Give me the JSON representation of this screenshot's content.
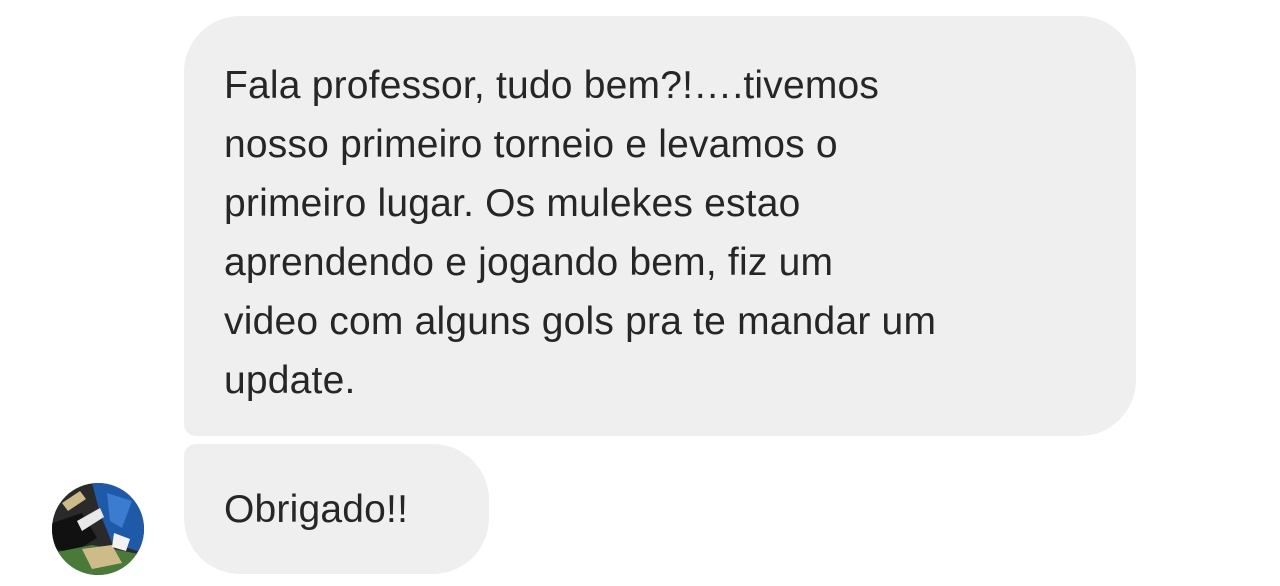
{
  "conversation": {
    "messages": [
      {
        "sender": "other",
        "text": "Fala professor, tudo bem?!….tivemos\nnosso primeiro torneio e levamos o\nprimeiro lugar. Os mulekes estao\naprendendo e jogando bem, fiz um\nvideo com alguns gols pra te mandar um\nupdate."
      },
      {
        "sender": "other",
        "text": "Obrigado!!"
      }
    ],
    "sender_avatar": {
      "icon": "profile-avatar",
      "colors": {
        "blue": "#1e5aa8",
        "dark": "#1a1a1a",
        "green": "#4a7a3a",
        "sand": "#cdbb8a"
      }
    }
  },
  "theme": {
    "bubble_color": "#efefef",
    "text_color": "#262626",
    "background": "#ffffff"
  }
}
